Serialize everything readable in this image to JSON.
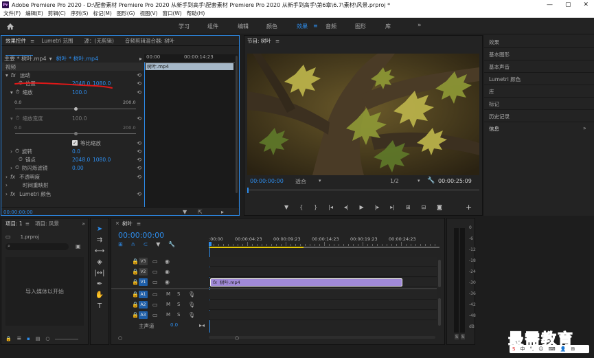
{
  "window": {
    "title": "Adobe Premiere Pro 2020 - D:\\配套素材 Premiere Pro 2020 从新手到高手\\配套素材 Premiere Pro 2020 从新手到高手\\第6章\\6.7\\素材\\风景.prproj *",
    "app_icon": "Pr"
  },
  "menu": [
    "文件(F)",
    "编辑(E)",
    "剪辑(C)",
    "序列(S)",
    "标记(M)",
    "图形(G)",
    "视图(V)",
    "窗口(W)",
    "帮助(H)"
  ],
  "workspaces": [
    "学习",
    "组件",
    "编辑",
    "颜色",
    "效果",
    "音频",
    "图形",
    "库"
  ],
  "workspace_active": "效果",
  "effect_controls": {
    "tabs": [
      "效果控件",
      "Lumetri 范围",
      "源：(无剪辑)",
      "音频剪辑混合器: 树叶"
    ],
    "master_label": "主要 * 树叶.mp4",
    "clip_label": "树叶 * 树叶.mp4",
    "ruler": [
      "00:00",
      "00:00:14:23"
    ],
    "clip_name": "树叶.mp4",
    "video_header": "视频",
    "motion": "运动",
    "position": {
      "label": "位置",
      "x": "2048.0",
      "y": "1080.0"
    },
    "scale": {
      "label": "缩放",
      "value": "100.0",
      "min": "0.0",
      "max": "200.0",
      "level": 0.5
    },
    "scale_width": {
      "label": "缩放宽度",
      "value": "100.0",
      "min": "0.0",
      "max": "200.0",
      "level": 0.5
    },
    "uniform_scale": "等比缩放",
    "rotation": {
      "label": "旋转",
      "value": "0.0"
    },
    "anchor": {
      "label": "锚点",
      "x": "2048.0",
      "y": "1080.0"
    },
    "flicker": {
      "label": "防闪烁滤镜",
      "value": "0.00"
    },
    "opacity": "不透明度",
    "time_remap": "时间重映射",
    "lumetri": "Lumetri 颜色",
    "timecode": "00:00:00:00",
    "fx_icon": "fx"
  },
  "program": {
    "title": "节目: 树叶",
    "timecode": "00:00:00:00",
    "fit": "适合",
    "quality": "1/2",
    "duration": "00:00:25:09"
  },
  "right_panel": [
    "效果",
    "基本图形",
    "基本声音",
    "Lumetri 颜色",
    "库",
    "标记",
    "历史记录",
    "信息"
  ],
  "project": {
    "tabs": [
      "项目: 1",
      "项目: 风景"
    ],
    "file": "1.prproj",
    "import_hint": "导入媒体以开始"
  },
  "timeline": {
    "tab": "树叶",
    "timecode": "00:00:00:00",
    "ruler": [
      ":00:00",
      "00:00:04:23",
      "00:00:09:23",
      "00:00:14:23",
      "00:00:19:23",
      "00:00:24:23"
    ],
    "video_tracks": [
      "V3",
      "V2",
      "V1"
    ],
    "audio_tracks": [
      "A1",
      "A2",
      "A3"
    ],
    "clip": "树叶.mp4",
    "master": "主声道",
    "master_value": "0.0",
    "m_label": "M",
    "s_label": "S"
  },
  "meters": {
    "scale": [
      "0",
      "-6",
      "-12",
      "-18",
      "-24",
      "-30",
      "-36",
      "-42",
      "-48",
      "dB"
    ],
    "solo": [
      "S",
      "S"
    ]
  },
  "watermark": "最需教育",
  "colors": {
    "accent": "#2d8ceb",
    "clip": "#a18ad8",
    "annotation": "#e01818",
    "playhead_yellow": "#e5c800"
  }
}
